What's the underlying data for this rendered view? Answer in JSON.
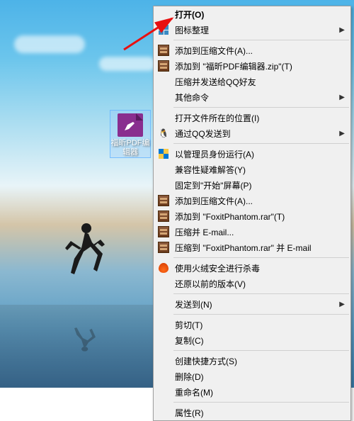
{
  "desktop_icon": {
    "label": "福昕PDF编辑器"
  },
  "menu": {
    "open": "打开(O)",
    "icon_arrange": "图标整理",
    "add_archive": "添加到压缩文件(A)...",
    "add_zip": "添加到 \"福昕PDF编辑器.zip\"(T)",
    "compress_qq": "压缩并发送给QQ好友",
    "other_cmd": "其他命令",
    "open_location": "打开文件所在的位置(I)",
    "qq_send": "通过QQ发送到",
    "run_admin": "以管理员身份运行(A)",
    "compat_troubleshoot": "兼容性疑难解答(Y)",
    "pin_start": "固定到\"开始\"屏幕(P)",
    "add_archive2": "添加到压缩文件(A)...",
    "add_rar": "添加到 \"FoxitPhantom.rar\"(T)",
    "compress_email": "压缩并 E-mail...",
    "compress_rar_email": "压缩到 \"FoxitPhantom.rar\" 并 E-mail",
    "huorong": "使用火绒安全进行杀毒",
    "restore": "还原以前的版本(V)",
    "send_to": "发送到(N)",
    "cut": "剪切(T)",
    "copy": "复制(C)",
    "shortcut": "创建快捷方式(S)",
    "delete": "删除(D)",
    "rename": "重命名(M)",
    "properties": "属性(R)"
  }
}
